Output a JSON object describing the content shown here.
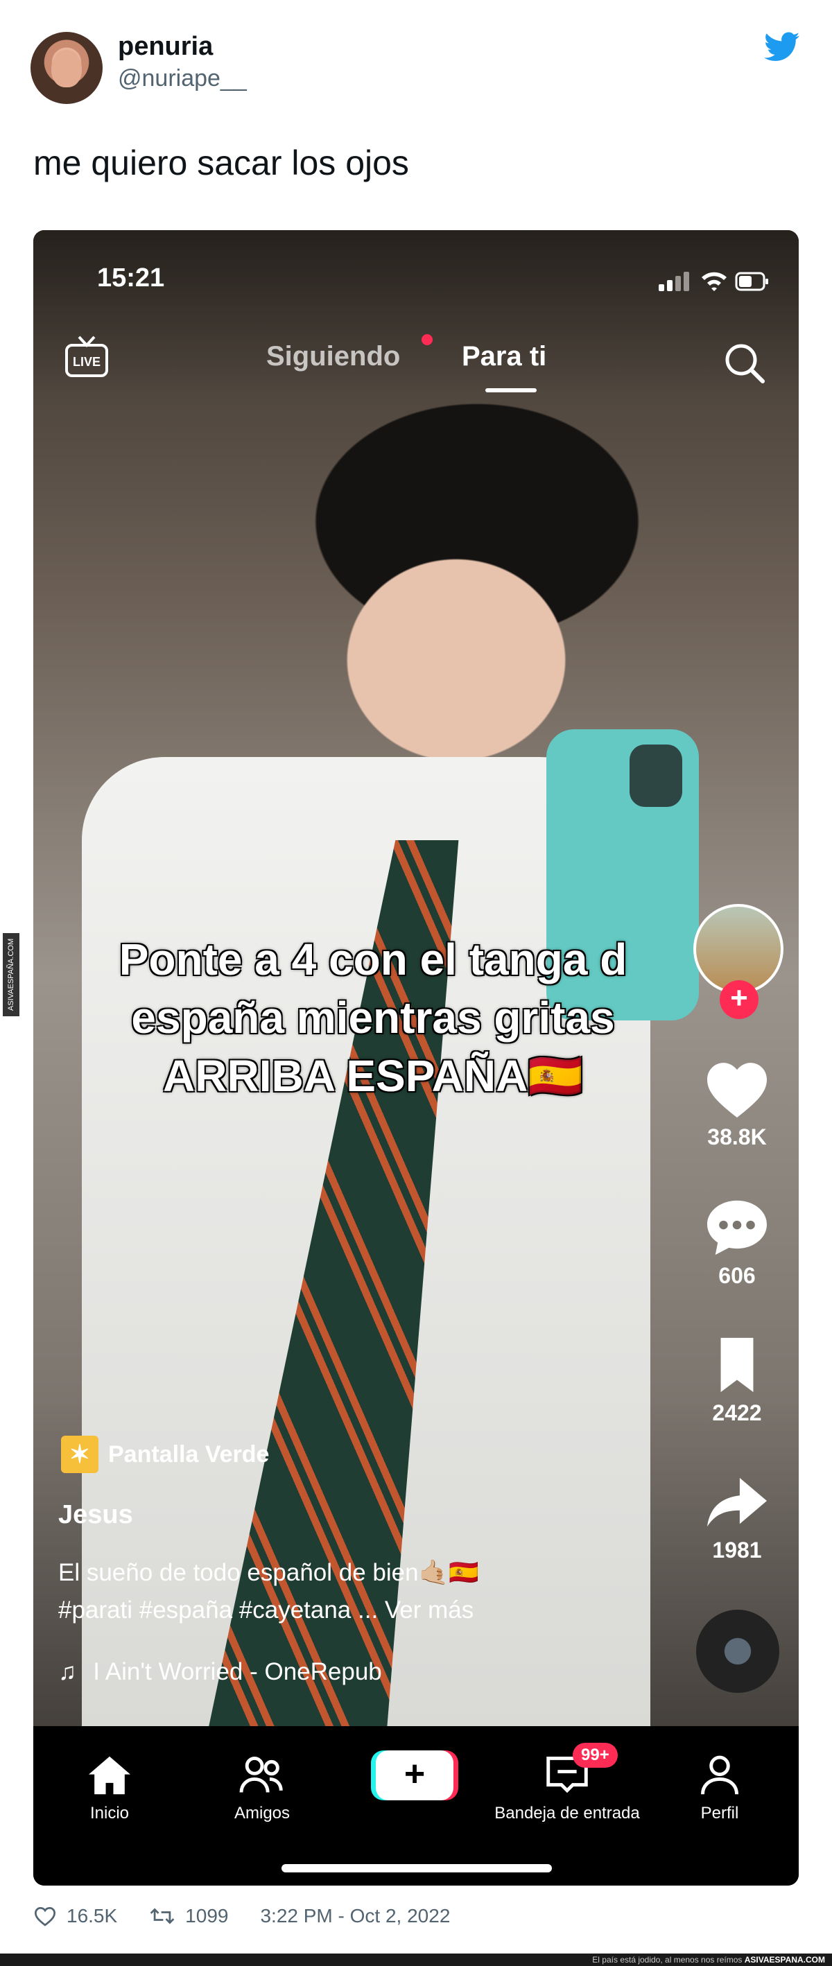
{
  "tweet": {
    "display_name": "penuria",
    "handle": "@nuriape__",
    "text": "me quiero sacar los ojos",
    "likes": "16.5K",
    "retweets": "1099",
    "timestamp": "3:22 PM - Oct 2, 2022"
  },
  "tiktok": {
    "status_time": "15:21",
    "live_label": "LIVE",
    "tab_following": "Siguiendo",
    "tab_for_you": "Para ti",
    "caption_lines": [
      "Ponte a 4 con el tanga d",
      "españa mientras gritas",
      "ARRIBA ESPAÑA🇪🇸"
    ],
    "likes": "38.8K",
    "comments": "606",
    "saves": "2422",
    "shares": "1981",
    "effect_label": "Pantalla Verde",
    "author": "Jesus",
    "description_line1": "El sueño de todo español de bien🤙🏼🇪🇸",
    "description_line2": "#parati #españa #cayetana ... Ver más",
    "music": "I Ain't Worried - OneRepub",
    "nav": {
      "home": "Inicio",
      "friends": "Amigos",
      "create": "+",
      "inbox": "Bandeja de entrada",
      "inbox_badge": "99+",
      "profile": "Perfil"
    }
  },
  "watermark": {
    "side": "ASIVAESPAÑA.COM",
    "footer_text": "El país está jodido, al menos nos reímos",
    "footer_brand": "ASIVAESPANA.COM"
  },
  "colors": {
    "twitter_blue": "#1d9bf0",
    "tiktok_red": "#fe2c55",
    "tiktok_cyan": "#25f4ee"
  }
}
